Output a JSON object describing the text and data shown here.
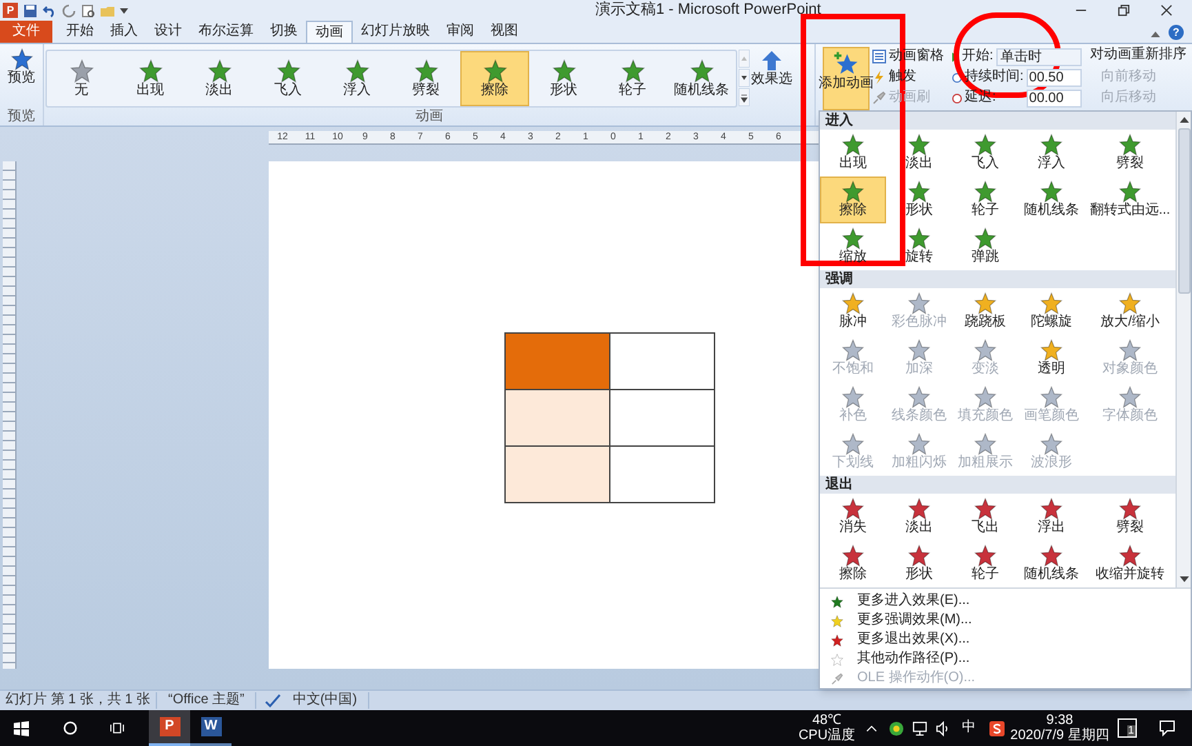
{
  "window": {
    "title": "演示文稿1 - Microsoft PowerPoint",
    "app_letter": "P",
    "help_glyph": "?"
  },
  "ribbon_tabs": [
    {
      "label": "文件",
      "kind": "file",
      "selected": false
    },
    {
      "label": "开始",
      "kind": "tab",
      "selected": false
    },
    {
      "label": "插入",
      "kind": "tab",
      "selected": false
    },
    {
      "label": "设计",
      "kind": "tab",
      "selected": false
    },
    {
      "label": "布尔运算",
      "kind": "tab",
      "selected": false
    },
    {
      "label": "切换",
      "kind": "tab",
      "selected": false
    },
    {
      "label": "动画",
      "kind": "tab",
      "selected": true
    },
    {
      "label": "幻灯片放映",
      "kind": "tab",
      "selected": false
    },
    {
      "label": "审阅",
      "kind": "tab",
      "selected": false
    },
    {
      "label": "视图",
      "kind": "tab",
      "selected": false
    }
  ],
  "preview_group": {
    "button": "预览",
    "group_label": "预览"
  },
  "animation_gallery": {
    "group_label": "动画",
    "effect_options": "效果选",
    "items": [
      {
        "label": "无",
        "kind": "none",
        "selected": false
      },
      {
        "label": "出现",
        "kind": "entrance",
        "selected": false
      },
      {
        "label": "淡出",
        "kind": "entrance",
        "selected": false
      },
      {
        "label": "飞入",
        "kind": "entrance",
        "selected": false
      },
      {
        "label": "浮入",
        "kind": "entrance",
        "selected": false
      },
      {
        "label": "劈裂",
        "kind": "entrance",
        "selected": false
      },
      {
        "label": "擦除",
        "kind": "entrance",
        "selected": true
      },
      {
        "label": "形状",
        "kind": "entrance",
        "selected": false
      },
      {
        "label": "轮子",
        "kind": "entrance",
        "selected": false
      },
      {
        "label": "随机线条",
        "kind": "entrance",
        "selected": false
      }
    ]
  },
  "advanced_animation": {
    "add_animation": "添加动画",
    "items": [
      {
        "label": "动画窗格",
        "disabled": false
      },
      {
        "label": "触发",
        "disabled": false
      },
      {
        "label": "动画刷",
        "disabled": true
      }
    ]
  },
  "timing": {
    "start_label": "开始:",
    "start_value": "单击时",
    "duration_label": "持续时间:",
    "duration_value": "00.50",
    "delay_label": "延迟:",
    "delay_value": "00.00",
    "reorder_title": "对动画重新排序",
    "reorder_items": [
      {
        "label": "向前移动",
        "disabled": true
      },
      {
        "label": "向后移动",
        "disabled": true
      }
    ]
  },
  "ruler": {
    "labels": [
      "12",
      "11",
      "10",
      "9",
      "8",
      "7",
      "6",
      "5",
      "4",
      "3",
      "2",
      "1",
      "0",
      "1",
      "2",
      "3",
      "4",
      "5",
      "6"
    ]
  },
  "slide": {
    "table": {
      "rows": [
        [
          {
            "color": "#e46c0a"
          },
          {
            "color": "#ffffff"
          }
        ],
        [
          {
            "color": "#fde9d9"
          },
          {
            "color": "#ffffff"
          }
        ],
        [
          {
            "color": "#fde9d9"
          },
          {
            "color": "#ffffff"
          }
        ]
      ]
    }
  },
  "effects_panel": {
    "sections": [
      {
        "title": "进入",
        "kind": "entrance",
        "items": [
          {
            "label": "出现",
            "disabled": false,
            "selected": false
          },
          {
            "label": "淡出",
            "disabled": false,
            "selected": false
          },
          {
            "label": "飞入",
            "disabled": false,
            "selected": false
          },
          {
            "label": "浮入",
            "disabled": false,
            "selected": false
          },
          {
            "label": "劈裂",
            "disabled": false,
            "selected": false
          },
          {
            "label": "擦除",
            "disabled": false,
            "selected": true
          },
          {
            "label": "形状",
            "disabled": false,
            "selected": false
          },
          {
            "label": "轮子",
            "disabled": false,
            "selected": false
          },
          {
            "label": "随机线条",
            "disabled": false,
            "selected": false
          },
          {
            "label": "翻转式由远...",
            "disabled": false,
            "selected": false
          },
          {
            "label": "缩放",
            "disabled": false,
            "selected": false
          },
          {
            "label": "旋转",
            "disabled": false,
            "selected": false
          },
          {
            "label": "弹跳",
            "disabled": false,
            "selected": false
          }
        ]
      },
      {
        "title": "强调",
        "kind": "emphasis",
        "items": [
          {
            "label": "脉冲",
            "disabled": false,
            "selected": false
          },
          {
            "label": "彩色脉冲",
            "disabled": true,
            "selected": false
          },
          {
            "label": "跷跷板",
            "disabled": false,
            "selected": false
          },
          {
            "label": "陀螺旋",
            "disabled": false,
            "selected": false
          },
          {
            "label": "放大/缩小",
            "disabled": false,
            "selected": false
          },
          {
            "label": "不饱和",
            "disabled": true,
            "selected": false
          },
          {
            "label": "加深",
            "disabled": true,
            "selected": false
          },
          {
            "label": "变淡",
            "disabled": true,
            "selected": false
          },
          {
            "label": "透明",
            "disabled": false,
            "selected": false
          },
          {
            "label": "对象颜色",
            "disabled": true,
            "selected": false
          },
          {
            "label": "补色",
            "disabled": true,
            "selected": false
          },
          {
            "label": "线条颜色",
            "disabled": true,
            "selected": false
          },
          {
            "label": "填充颜色",
            "disabled": true,
            "selected": false
          },
          {
            "label": "画笔颜色",
            "disabled": true,
            "selected": false
          },
          {
            "label": "字体颜色",
            "disabled": true,
            "selected": false
          },
          {
            "label": "下划线",
            "disabled": true,
            "selected": false
          },
          {
            "label": "加粗闪烁",
            "disabled": true,
            "selected": false
          },
          {
            "label": "加粗展示",
            "disabled": true,
            "selected": false
          },
          {
            "label": "波浪形",
            "disabled": true,
            "selected": false
          }
        ]
      },
      {
        "title": "退出",
        "kind": "exit",
        "items": [
          {
            "label": "消失",
            "disabled": false,
            "selected": false
          },
          {
            "label": "淡出",
            "disabled": false,
            "selected": false
          },
          {
            "label": "飞出",
            "disabled": false,
            "selected": false
          },
          {
            "label": "浮出",
            "disabled": false,
            "selected": false
          },
          {
            "label": "劈裂",
            "disabled": false,
            "selected": false
          },
          {
            "label": "擦除",
            "disabled": false,
            "selected": false
          },
          {
            "label": "形状",
            "disabled": false,
            "selected": false
          },
          {
            "label": "轮子",
            "disabled": false,
            "selected": false
          },
          {
            "label": "随机线条",
            "disabled": false,
            "selected": false
          },
          {
            "label": "收缩并旋转",
            "disabled": false,
            "selected": false
          }
        ]
      }
    ],
    "menu": [
      {
        "label": "更多进入效果(E)...",
        "kind": "entrance",
        "disabled": false
      },
      {
        "label": "更多强调效果(M)...",
        "kind": "emphasis",
        "disabled": false
      },
      {
        "label": "更多退出效果(X)...",
        "kind": "exit",
        "disabled": false
      },
      {
        "label": "其他动作路径(P)...",
        "kind": "path",
        "disabled": false
      },
      {
        "label": "OLE 操作动作(O)...",
        "kind": "ole",
        "disabled": true
      }
    ]
  },
  "status_bar": {
    "slide_info": "幻灯片 第 1 张，共 1 张",
    "theme": "“Office 主题”",
    "language": "中文(中国)"
  },
  "taskbar": {
    "apps": [
      {
        "kind": "powerpoint",
        "letter": "P",
        "active": true
      },
      {
        "kind": "word",
        "letter": "W",
        "active": false
      }
    ],
    "cpu_temp": "48℃",
    "cpu_label": "CPU温度",
    "ime": "中",
    "time": "9:38",
    "date": "2020/7/9 星期四",
    "notification_count": "1"
  },
  "annotations": {
    "highlight_rectangle": true,
    "highlight_ellipse": true
  }
}
